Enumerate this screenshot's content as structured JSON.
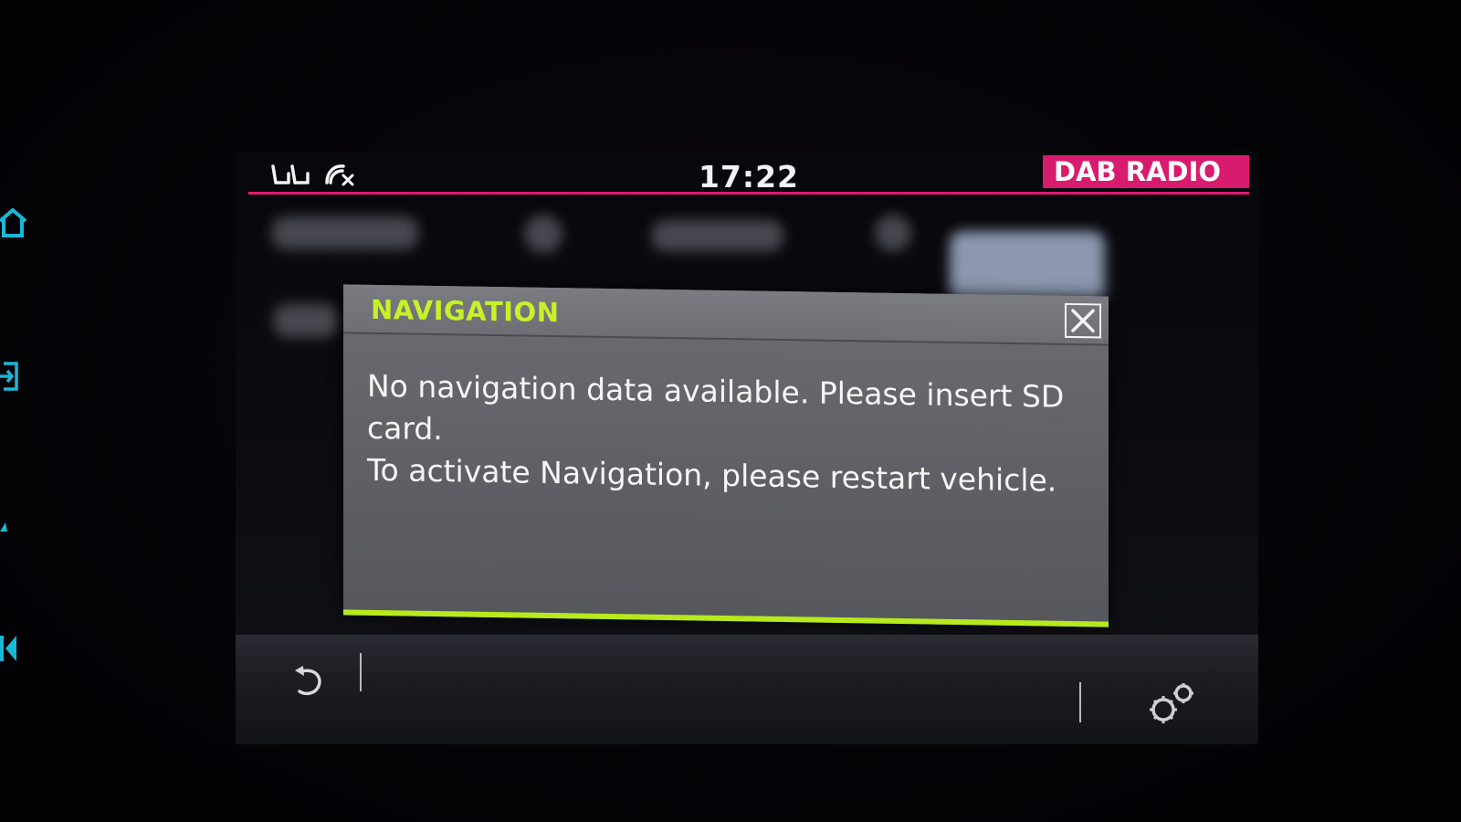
{
  "status_bar": {
    "clock": "17:22",
    "source_label": "DAB RADIO",
    "icons": [
      "seat-heating-icon",
      "phone-disconnected-icon"
    ]
  },
  "dialog": {
    "title": "NAVIGATION",
    "message_line1": "No navigation data available. Please insert SD card.",
    "message_line2": "To activate Navigation, please restart vehicle.",
    "close_icon": "close-icon"
  },
  "bottom_bar": {
    "back_icon": "back-arrow-icon",
    "settings_icon": "settings-gears-icon"
  },
  "side_controls": [
    "home-icon",
    "source-icon",
    "triangle-icon",
    "skip-back-icon"
  ],
  "colors": {
    "accent_pink": "#d81b6e",
    "accent_green": "#c6f227",
    "side_cyan": "#19b8d6",
    "dialog_gray": "#6c6d72"
  }
}
